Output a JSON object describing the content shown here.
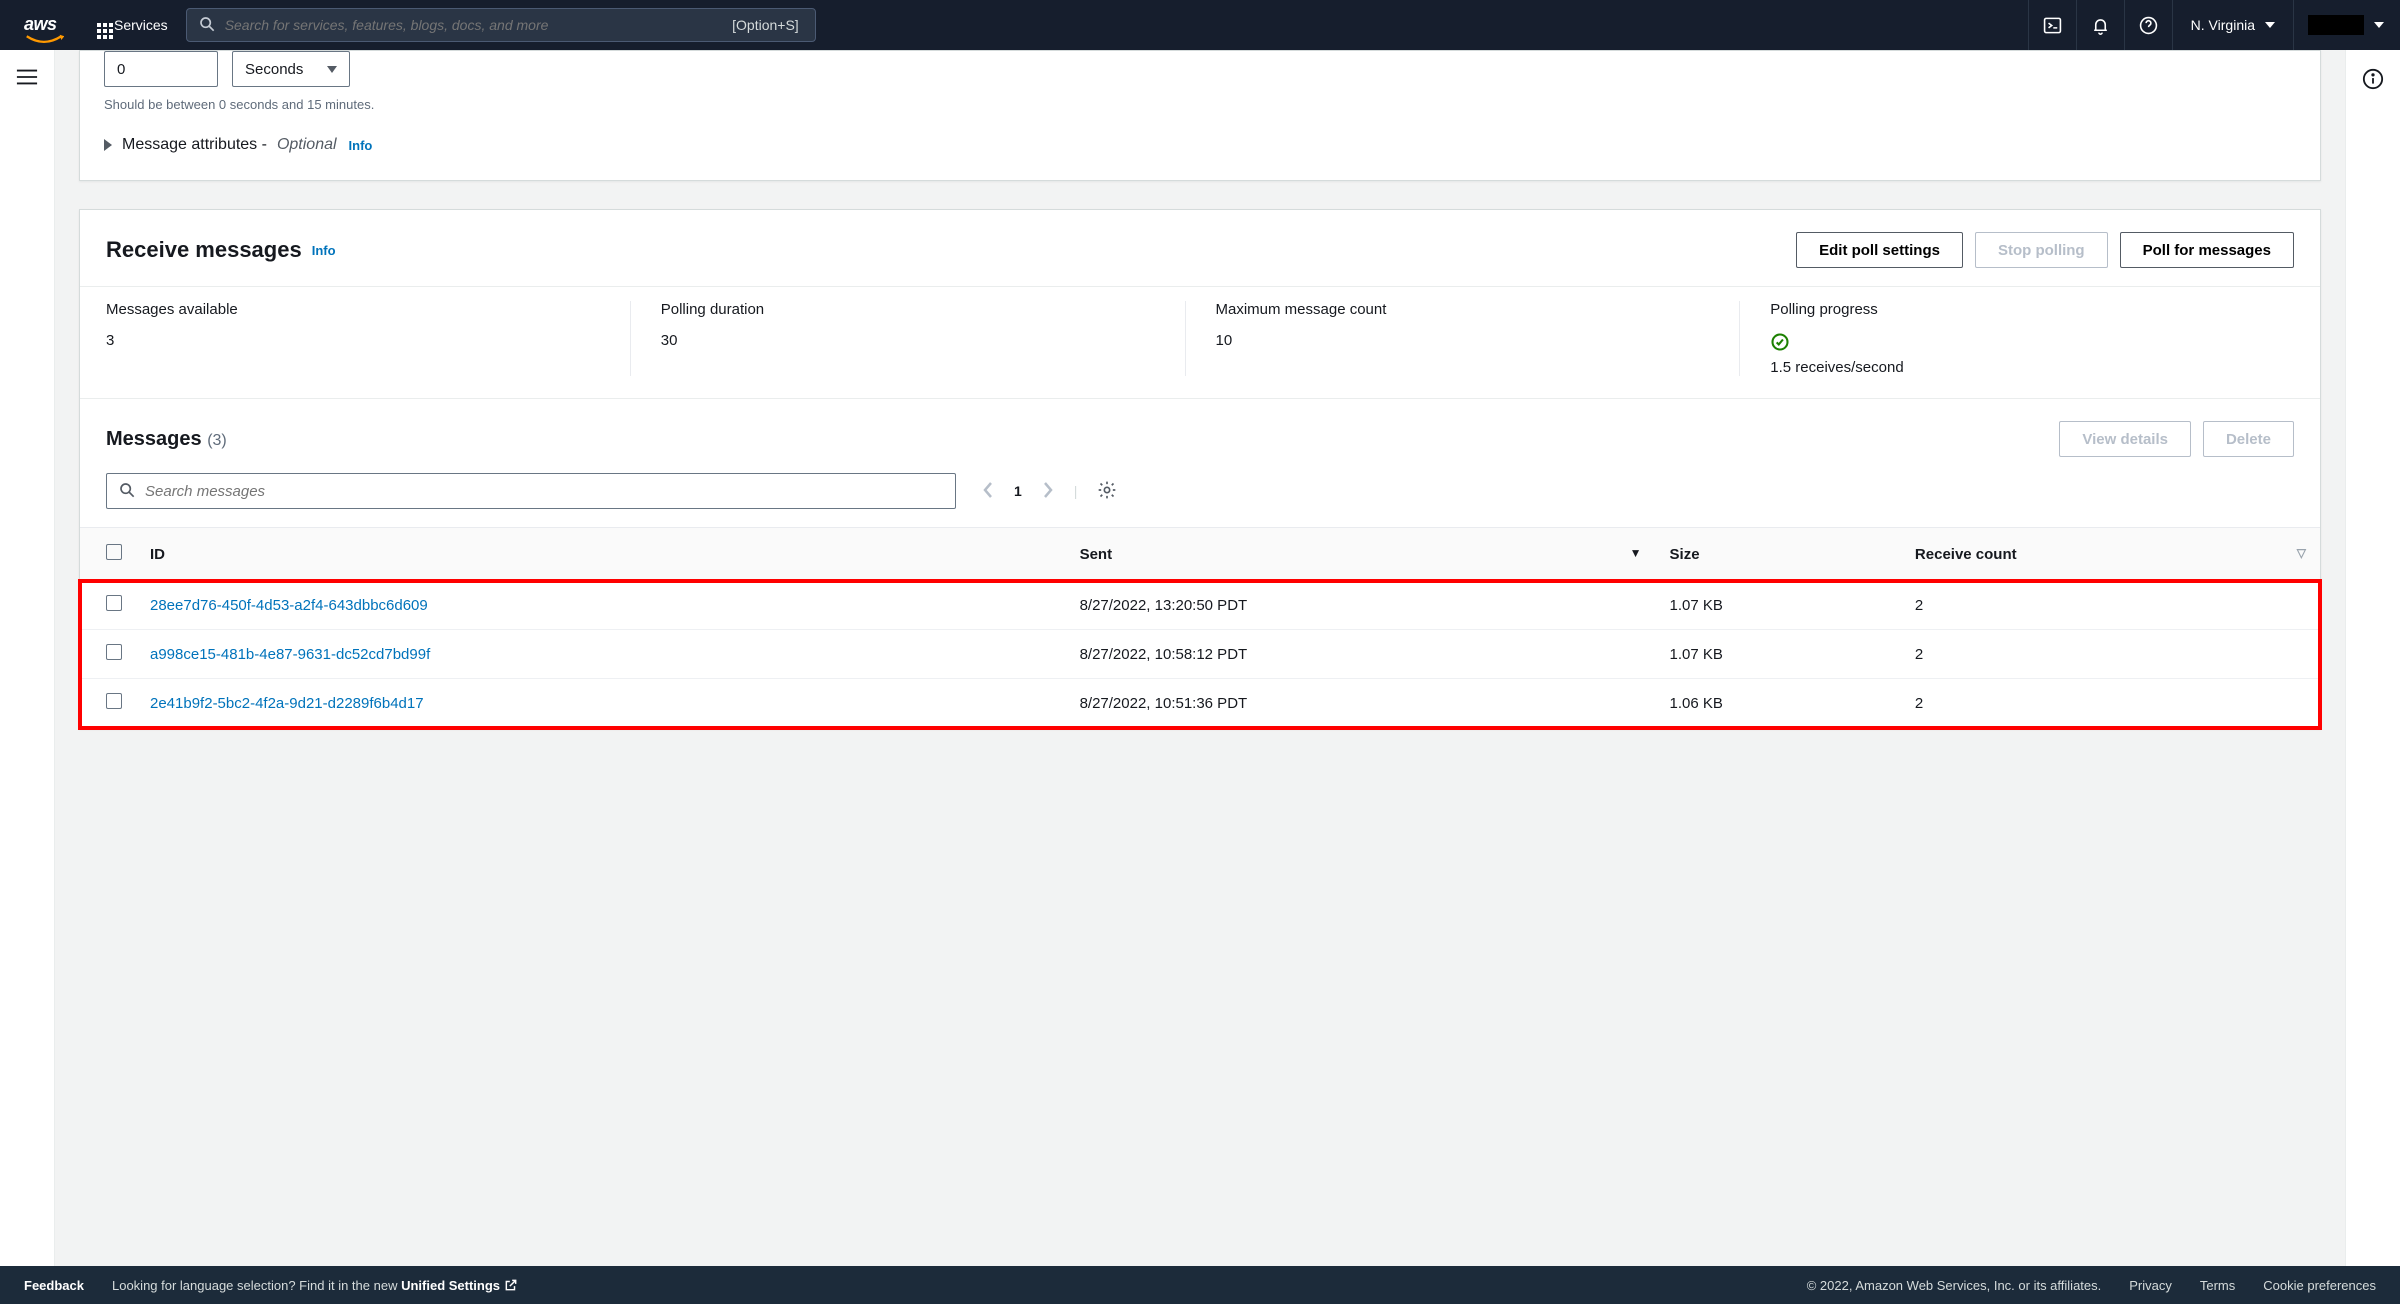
{
  "topnav": {
    "services_label": "Services",
    "search_placeholder": "Search for services, features, blogs, docs, and more",
    "search_shortcut": "[Option+S]",
    "region": "N. Virginia"
  },
  "panel_top": {
    "number_value": "0",
    "unit_selected": "Seconds",
    "hint": "Should be between 0 seconds and 15 minutes.",
    "expander_label": "Message attributes -",
    "expander_optional": "Optional",
    "info": "Info"
  },
  "receive": {
    "title": "Receive messages",
    "info": "Info",
    "buttons": {
      "edit": "Edit poll settings",
      "stop": "Stop polling",
      "poll": "Poll for messages"
    },
    "stats": {
      "available_label": "Messages available",
      "available_value": "3",
      "duration_label": "Polling duration",
      "duration_value": "30",
      "max_label": "Maximum message count",
      "max_value": "10",
      "progress_label": "Polling progress",
      "progress_value": "1.5 receives/second"
    }
  },
  "messages": {
    "title": "Messages",
    "count": "(3)",
    "view_details": "View details",
    "delete": "Delete",
    "search_placeholder": "Search messages",
    "page": "1",
    "columns": {
      "id": "ID",
      "sent": "Sent",
      "size": "Size",
      "recv": "Receive count"
    },
    "rows": [
      {
        "id": "28ee7d76-450f-4d53-a2f4-643dbbc6d609",
        "sent": "8/27/2022, 13:20:50 PDT",
        "size": "1.07 KB",
        "recv": "2"
      },
      {
        "id": "a998ce15-481b-4e87-9631-dc52cd7bd99f",
        "sent": "8/27/2022, 10:58:12 PDT",
        "size": "1.07 KB",
        "recv": "2"
      },
      {
        "id": "2e41b9f2-5bc2-4f2a-9d21-d2289f6b4d17",
        "sent": "8/27/2022, 10:51:36 PDT",
        "size": "1.06 KB",
        "recv": "2"
      }
    ]
  },
  "footer": {
    "feedback": "Feedback",
    "lang_tip": "Looking for language selection? Find it in the new",
    "unified": "Unified Settings",
    "copyright": "© 2022, Amazon Web Services, Inc. or its affiliates.",
    "privacy": "Privacy",
    "terms": "Terms",
    "cookies": "Cookie preferences"
  }
}
